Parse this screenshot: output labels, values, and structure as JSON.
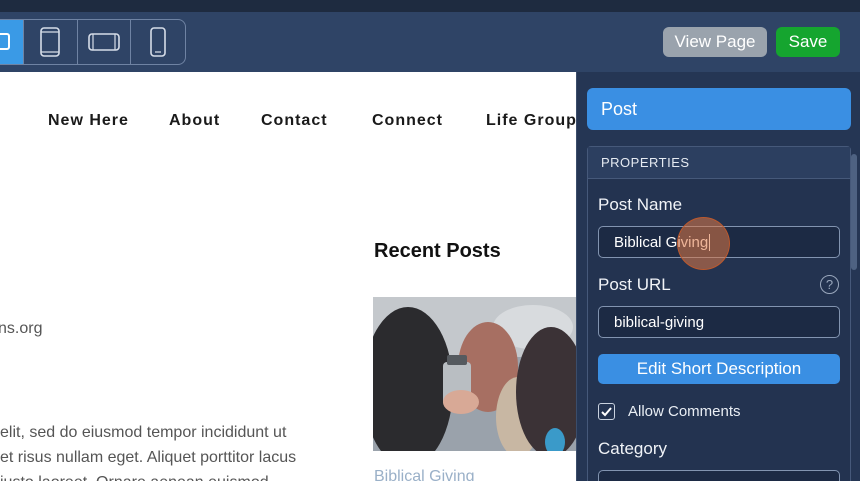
{
  "toolbar": {
    "devices": [
      {
        "name": "desktop-icon"
      },
      {
        "name": "tablet-portrait-icon"
      },
      {
        "name": "tablet-landscape-icon"
      },
      {
        "name": "mobile-icon"
      }
    ],
    "view_page_label": "View Page",
    "save_label": "Save"
  },
  "site": {
    "nav": [
      "New Here",
      "About",
      "Contact",
      "Connect",
      "Life Groups"
    ],
    "recent_posts_heading": "Recent Posts",
    "email_fragment": "ns.org",
    "lorem": [
      "elit, sed do eiusmod tempor incididunt ut",
      "et risus nullam eget. Aliquet porttitor lacus",
      "justo laoreet. Ornare aenean euismod"
    ],
    "post_link": "Biblical Giving"
  },
  "panel": {
    "header": "Post",
    "properties_title": "PROPERTIES",
    "post_name_label": "Post Name",
    "post_name_value": "Biblical Giving",
    "post_url_label": "Post URL",
    "post_url_value": "biblical-giving",
    "help_glyph": "?",
    "edit_desc_label": "Edit Short Description",
    "allow_comments_label": "Allow Comments",
    "allow_comments_checked": true,
    "category_label": "Category"
  },
  "colors": {
    "toolbar": "#2f4466",
    "panel": "#253654",
    "accent": "#3a8fe3",
    "save": "#15a52f",
    "view": "#9aa3ad"
  }
}
